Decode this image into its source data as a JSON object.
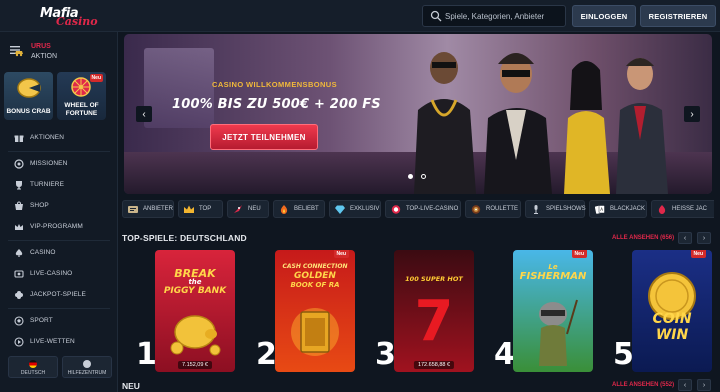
{
  "header": {
    "logo_word": "Mafia",
    "logo_script": "Casino",
    "search_placeholder": "Spiele, Kategorien, Anbieter",
    "login_label": "EINLOGGEN",
    "register_label": "REGISTRIEREN"
  },
  "sidebar": {
    "promo": {
      "title": "URUS",
      "subtitle": "AKTION"
    },
    "tiles": [
      {
        "label": "BONUS CRAB"
      },
      {
        "label": "WHEEL OF FORTUNE",
        "badge": "Neu"
      }
    ],
    "items": [
      {
        "label": "AKTIONEN",
        "icon": "gift-icon"
      },
      {
        "label": "MISSIONEN",
        "icon": "target-icon"
      },
      {
        "label": "TURNIERE",
        "icon": "trophy-icon"
      },
      {
        "label": "SHOP",
        "icon": "shop-icon"
      },
      {
        "label": "VIP-PROGRAMM",
        "icon": "crown-icon"
      },
      {
        "label": "CASINO",
        "icon": "spade-icon"
      },
      {
        "label": "LIVE-CASINO",
        "icon": "live-icon"
      },
      {
        "label": "JACKPOT-SPIELE",
        "icon": "clover-icon"
      },
      {
        "label": "SPORT",
        "icon": "ball-icon"
      },
      {
        "label": "LIVE-WETTEN",
        "icon": "live-bet-icon"
      }
    ],
    "bottom": [
      {
        "label": "DEUTSCH",
        "icon": "flag-icon"
      },
      {
        "label": "HILFEZENTRUM",
        "icon": "help-icon"
      }
    ]
  },
  "banner": {
    "kicker": "CASINO WILLKOMMENSBONUS",
    "headline": "100% BIS ZU 500€ + 200 FS",
    "cta": "JETZT TEILNEHMEN",
    "slides": 2,
    "active_slide": 1
  },
  "categories": [
    {
      "label": "ANBIETER",
      "icon": "provider-icon"
    },
    {
      "label": "TOP",
      "icon": "crown-icon"
    },
    {
      "label": "NEU",
      "icon": "rocket-icon"
    },
    {
      "label": "BELIEBT",
      "icon": "fire-icon"
    },
    {
      "label": "EXKLUSIV",
      "icon": "diamond-icon"
    },
    {
      "label": "TOP-LIVE-CASINO",
      "icon": "chip-icon"
    },
    {
      "label": "ROULETTE",
      "icon": "roulette-icon"
    },
    {
      "label": "SPIELSHOWS",
      "icon": "microphone-icon"
    },
    {
      "label": "BLACKJACK",
      "icon": "cards-icon"
    },
    {
      "label": "HEISSE JAC",
      "icon": "hot-icon"
    }
  ],
  "top_games": {
    "title": "TOP-SPIELE: DEUTSCHLAND",
    "see_all": "ALLE ANSEHEN (656)",
    "games": [
      {
        "rank": "1",
        "title_a": "BREAK",
        "title_b": "the",
        "title_c": "PIGGY BANK",
        "jackpot": "7.152,09 €",
        "badge": ""
      },
      {
        "rank": "2",
        "title_a": "CASH CONNECTION",
        "title_b": "GOLDEN",
        "title_c": "BOOK OF RA",
        "jackpot": "",
        "badge": "Neu"
      },
      {
        "rank": "3",
        "title_a": "100 SUPER HOT",
        "title_b": "7",
        "title_c": "",
        "jackpot": "172.658,88 €",
        "badge": ""
      },
      {
        "rank": "4",
        "title_a": "Le",
        "title_b": "FISHERMAN",
        "title_c": "",
        "jackpot": "",
        "badge": "Neu"
      },
      {
        "rank": "5",
        "title_a": "COIN",
        "title_b": "WIN",
        "title_c": "",
        "jackpot": "",
        "badge": "Neu"
      }
    ]
  },
  "new_section": {
    "title": "NEU",
    "see_all": "ALLE ANSEHEN (552)"
  },
  "colors": {
    "accent": "#e0284a",
    "bg": "#0f1620",
    "panel": "#151e2a"
  }
}
